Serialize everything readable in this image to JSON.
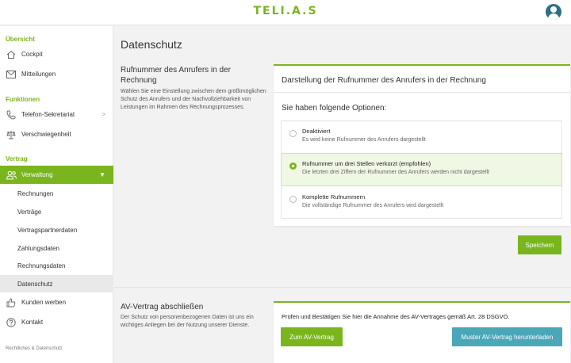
{
  "header": {
    "logo": "TELI.A.S",
    "avatar_icon": "user-icon"
  },
  "sidebar": {
    "sections": [
      {
        "label": "Übersicht"
      },
      {
        "label": "Funktionen"
      },
      {
        "label": "Vertrag"
      }
    ],
    "items": [
      {
        "label": "Cockpit",
        "icon": "home-icon"
      },
      {
        "label": "Mitteilungen",
        "icon": "mail-icon"
      },
      {
        "label": "Telefon-Sekretariat",
        "icon": "phone-icon",
        "chevron": ">"
      },
      {
        "label": "Verschwiegenheit",
        "icon": "scales-icon"
      },
      {
        "label": "Verwaltung",
        "icon": "users-icon",
        "chevron": "▼"
      },
      {
        "label": "Kunden werben",
        "icon": "thumbs-up-icon"
      },
      {
        "label": "Kontakt",
        "icon": "help-icon"
      }
    ],
    "subitems": [
      {
        "label": "Rechnungen"
      },
      {
        "label": "Verträge"
      },
      {
        "label": "Vertragspartnerdaten"
      },
      {
        "label": "Zahlungsdaten"
      },
      {
        "label": "Rechnungsdaten"
      },
      {
        "label": "Datenschutz"
      }
    ],
    "footer": "Rechtliches & Datenschutz"
  },
  "main": {
    "page_title": "Datenschutz",
    "section1": {
      "heading": "Rufnummer des Anrufers in der Rechnung",
      "description": "Wählen Sie eine Einstellung zwischen dem größtmöglichen Schutz des Anrufers und der Nachvollziehbarkeit von Leistungen im Rahmen des Rechnungsprozesses.",
      "card_title": "Darstellung der Rufnummer des Anrufers in der Rechnung",
      "options_title": "Sie haben folgende Optionen:",
      "options": [
        {
          "label": "Deaktiviert",
          "desc": "Es wird keine Rufnummer des Anrufers dargestellt",
          "selected": false
        },
        {
          "label": "Rufnummer um drei Stellen verkürzt (empfohlen)",
          "desc": "Die letzten drei Ziffern der Rufnummer des Anrufers werden nicht dargestellt",
          "selected": true
        },
        {
          "label": "Komplette Rufnummern",
          "desc": "Die vollständige Rufnummer des Anrufers wird dargestellt",
          "selected": false
        }
      ],
      "save_label": "Speichern"
    },
    "section2": {
      "heading": "AV-Vertrag abschließen",
      "description": "Der Schutz von personenbezogenen Daten ist uns ein wichtiges Anliegen bei der Nutzung unserer Dienste.",
      "card_text": "Prüfen und Bestätigen Sie hier die Annahme des AV-Vertrages gemäß Art. 28 DSGVO.",
      "primary_button": "Zum AV-Vertrag",
      "secondary_button": "Muster AV-Vertrag herunterladen"
    }
  },
  "colors": {
    "accent": "#7ab51d",
    "teal": "#4aa7b8",
    "avatar": "#2d6f86"
  }
}
